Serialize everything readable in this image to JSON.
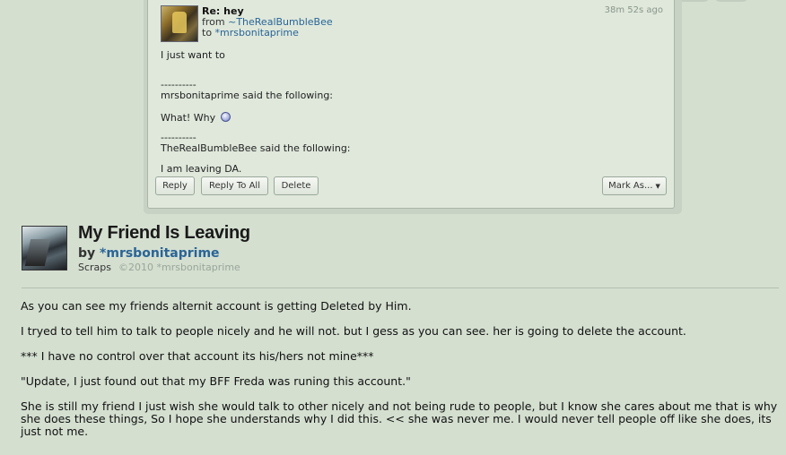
{
  "note": {
    "subject": "Re: hey",
    "from_prefix": "from ",
    "from_user": "~TheRealBumbleBee",
    "to_prefix": "to ",
    "to_user": "*mrsbonitaprime",
    "time": "38m 52s ago",
    "body": {
      "line1": "I just want to",
      "sep1": "----------",
      "quote1_header": "mrsbonitaprime said the following:",
      "quote1_text": "What! Why",
      "sep2": "----------",
      "quote2_header": "TheRealBumbleBee said the following:",
      "quote2_text": "I am leaving DA."
    },
    "buttons": {
      "reply": "Reply",
      "reply_all": "Reply To All",
      "delete": "Delete",
      "mark_as": "Mark As..."
    }
  },
  "deviation": {
    "title": "My Friend Is Leaving",
    "by_prefix": "by ",
    "author": "*mrsbonitaprime",
    "category": "Scraps",
    "copyright": "©2010 *mrsbonitaprime",
    "description": [
      "As you can see my friends alternit account is getting Deleted by Him.",
      "I tryed to tell him to talk to people nicely and he will not. but I gess as you can see. her is going to delete the account.",
      "*** I have no control over that account its his/hers not mine***",
      "\"Update, I just found out that my BFF Freda was runing this account.\"",
      "She is still my friend I just wish she would talk to other nicely and not being rude to people, but I know she cares about me that is why she does these things, So I hope she understands why I did this. << she was never me. I would never tell people off like she does, its just not me."
    ]
  }
}
